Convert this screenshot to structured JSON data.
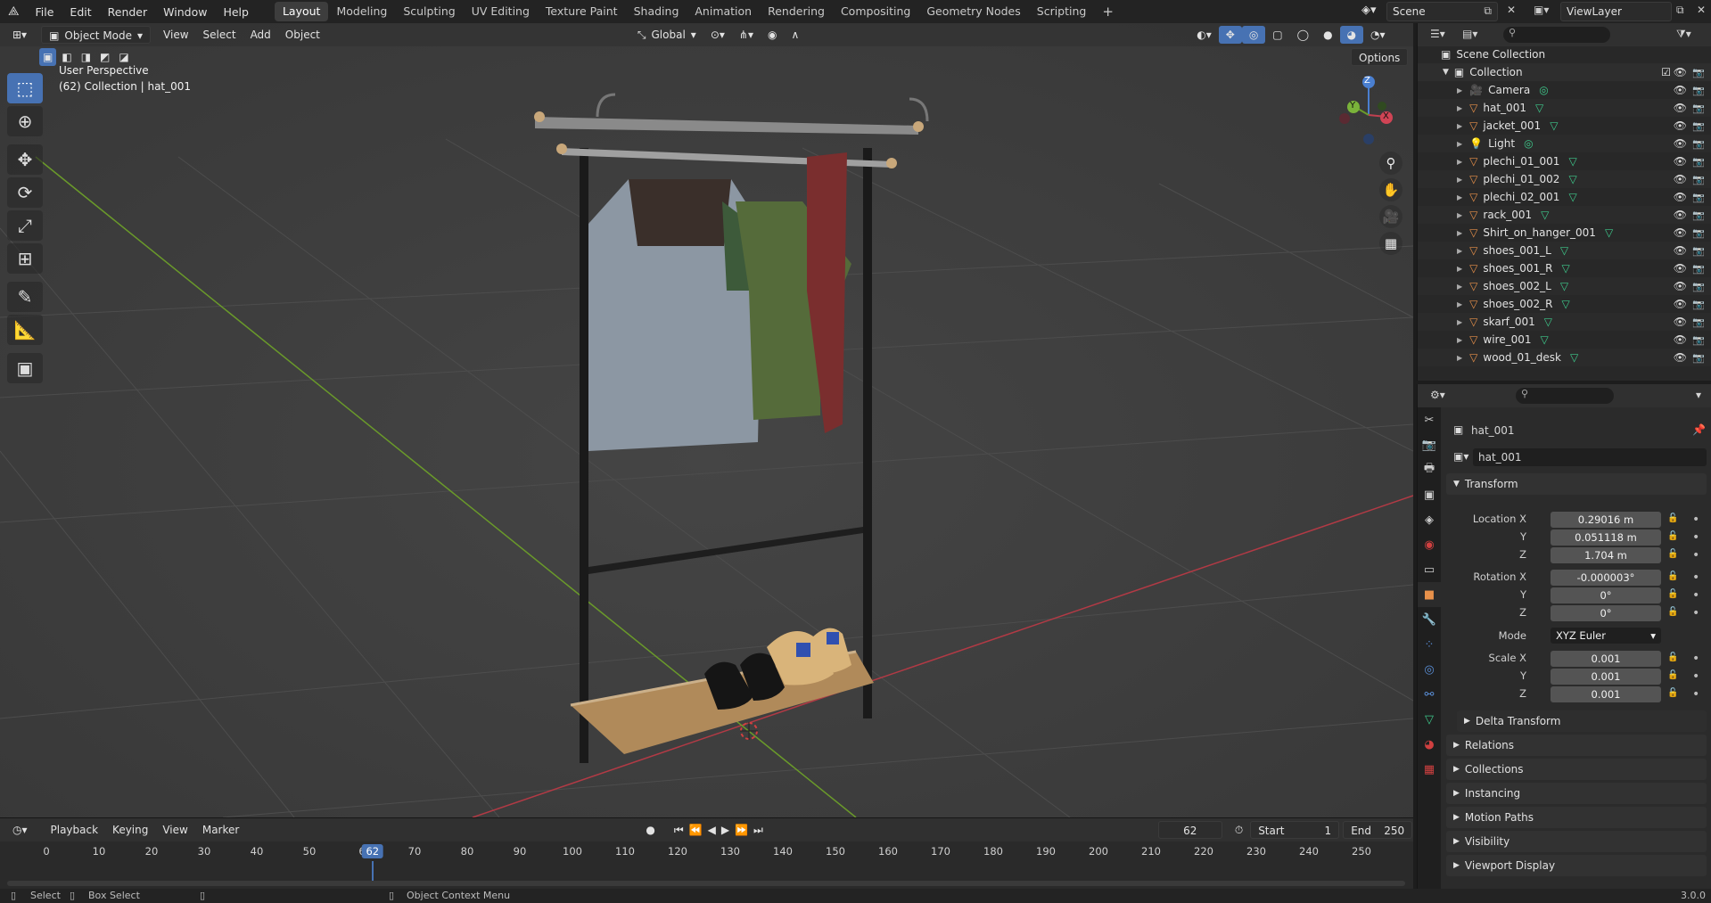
{
  "topbar": {
    "menus": [
      "File",
      "Edit",
      "Render",
      "Window",
      "Help"
    ],
    "workspaces": [
      "Layout",
      "Modeling",
      "Sculpting",
      "UV Editing",
      "Texture Paint",
      "Shading",
      "Animation",
      "Rendering",
      "Compositing",
      "Geometry Nodes",
      "Scripting"
    ],
    "active_workspace": "Layout",
    "add_tab": "+",
    "scene": "Scene",
    "view_layer": "ViewLayer"
  },
  "viewport": {
    "mode": "Object Mode",
    "menus": [
      "View",
      "Select",
      "Add",
      "Object"
    ],
    "orientation": "Global",
    "options_label": "Options",
    "overlay_line1": "User Perspective",
    "overlay_line2": "(62) Collection | hat_001",
    "gizmo": {
      "x": "X",
      "y": "Y",
      "z": "Z"
    }
  },
  "timeline": {
    "menus": [
      "Playback",
      "Keying",
      "View",
      "Marker"
    ],
    "current_frame": "62",
    "start_label": "Start",
    "start": "1",
    "end_label": "End",
    "end": "250",
    "ticks": [
      "0",
      "10",
      "20",
      "30",
      "40",
      "50",
      "6",
      "70",
      "80",
      "90",
      "100",
      "110",
      "120",
      "130",
      "140",
      "150",
      "160",
      "170",
      "180",
      "190",
      "200",
      "210",
      "220",
      "230",
      "240",
      "250"
    ],
    "cursor_label": "62"
  },
  "status": {
    "select": "Select",
    "box_select": "Box Select",
    "context_menu": "Object Context Menu",
    "version": "3.0.0"
  },
  "outliner": {
    "root": "Scene Collection",
    "collection": "Collection",
    "items": [
      {
        "name": "Camera",
        "icon": "camera-icon"
      },
      {
        "name": "hat_001",
        "icon": "mesh-icon"
      },
      {
        "name": "jacket_001",
        "icon": "mesh-icon"
      },
      {
        "name": "Light",
        "icon": "light-icon"
      },
      {
        "name": "plechi_01_001",
        "icon": "mesh-icon"
      },
      {
        "name": "plechi_01_002",
        "icon": "mesh-icon"
      },
      {
        "name": "plechi_02_001",
        "icon": "mesh-icon"
      },
      {
        "name": "rack_001",
        "icon": "mesh-icon"
      },
      {
        "name": "Shirt_on_hanger_001",
        "icon": "mesh-icon"
      },
      {
        "name": "shoes_001_L",
        "icon": "mesh-icon"
      },
      {
        "name": "shoes_001_R",
        "icon": "mesh-icon"
      },
      {
        "name": "shoes_002_L",
        "icon": "mesh-icon"
      },
      {
        "name": "shoes_002_R",
        "icon": "mesh-icon"
      },
      {
        "name": "skarf_001",
        "icon": "mesh-icon"
      },
      {
        "name": "wire_001",
        "icon": "mesh-icon"
      },
      {
        "name": "wood_01_desk",
        "icon": "mesh-icon"
      }
    ]
  },
  "properties": {
    "object_name": "hat_001",
    "data_name": "hat_001",
    "transform_label": "Transform",
    "location": {
      "label_x": "Location X",
      "label_y": "Y",
      "label_z": "Z",
      "x": "0.29016 m",
      "y": "0.051118 m",
      "z": "1.704 m"
    },
    "rotation": {
      "label_x": "Rotation X",
      "label_y": "Y",
      "label_z": "Z",
      "x": "-0.000003°",
      "y": "0°",
      "z": "0°"
    },
    "mode_label": "Mode",
    "mode": "XYZ Euler",
    "scale": {
      "label_x": "Scale X",
      "label_y": "Y",
      "label_z": "Z",
      "x": "0.001",
      "y": "0.001",
      "z": "0.001"
    },
    "delta_transform": "Delta Transform",
    "panels": [
      "Relations",
      "Collections",
      "Instancing",
      "Motion Paths",
      "Visibility",
      "Viewport Display"
    ]
  },
  "colors": {
    "accent": "#4772b3",
    "mesh": "#e8914a",
    "data": "#3ec98b",
    "grid_red": "#b23a45",
    "grid_green": "#6a9a2a"
  }
}
